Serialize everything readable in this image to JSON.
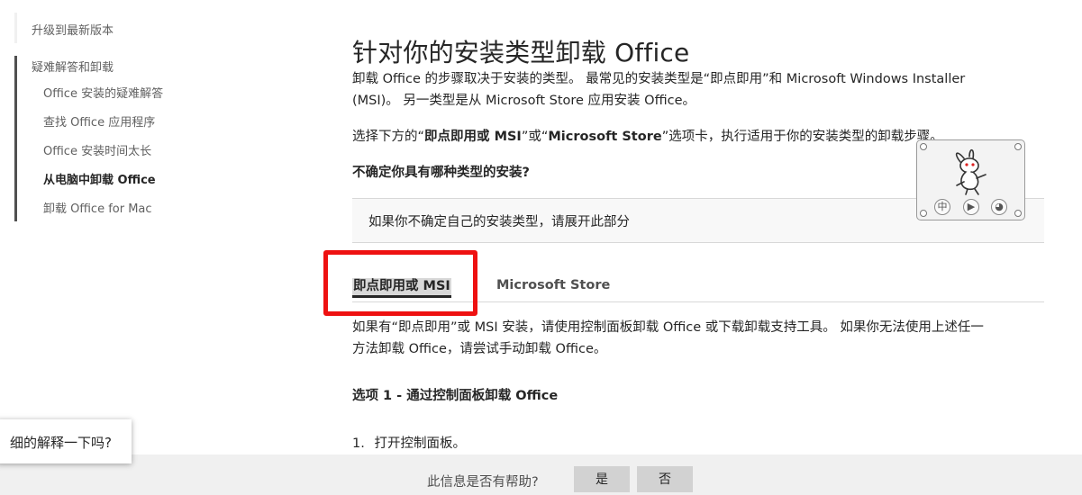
{
  "sidebar": {
    "items": [
      {
        "label": "升级到最新版本"
      },
      {
        "label": "疑难解答和卸载"
      },
      {
        "label": "Office 安装的疑难解答"
      },
      {
        "label": "查找 Office 应用程序"
      },
      {
        "label": "Office 安装时间太长"
      },
      {
        "label": "从电脑中卸载 Office"
      },
      {
        "label": "卸载 Office for Mac"
      }
    ]
  },
  "article": {
    "title": "针对你的安装类型卸载 Office",
    "intro_line1": "卸载 Office 的步骤取决于安装的类型。 最常见的安装类型是“即点即用”和 Microsoft Windows Installer",
    "intro_line2": "(MSI)。 另一类型是从 Microsoft Store 应用安装 Office。",
    "select_pre": "选择下方的“",
    "select_tab1": "即点即用或 MSI",
    "select_mid": "”或“",
    "select_tab2": "Microsoft Store",
    "select_post": "”选项卡，执行适用于你的安装类型的卸载步骤。",
    "unsure_heading": "不确定你具有哪种类型的安装?",
    "collapse_text": "如果你不确定自己的安装类型，请展开此部分",
    "tabs": [
      {
        "label": "即点即用或 MSI"
      },
      {
        "label": "Microsoft Store"
      }
    ],
    "body_line1": "如果有“即点即用”或 MSI 安装，请使用控制面板卸载 Office 或下载卸载支持工具。 如果你无法使用上述任一",
    "body_line2": "方法卸载 Office，请尝试手动卸载 Office。",
    "option_heading": "选项 1 - 通过控制面板卸载 Office",
    "step_number": "1.",
    "step_text": "打开控制面板。"
  },
  "widget": {
    "btn_cn": "中",
    "btn_play": "▶",
    "btn_other": "◕"
  },
  "popup": {
    "text": "细的解释一下吗?"
  },
  "feedback": {
    "question": "此信息是否有帮助?",
    "yes_label": "是",
    "no_label": "否"
  },
  "colors": {
    "highlight_box": "#ee1111",
    "tab_active_bg": "#d8d8d8"
  }
}
